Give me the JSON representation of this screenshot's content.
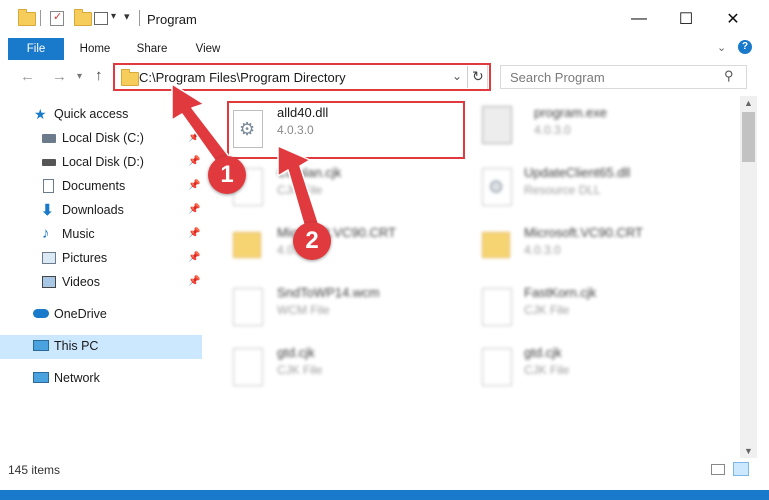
{
  "window": {
    "title": "Program"
  },
  "titlebar": {
    "minimize_icon": "minimize-icon",
    "maximize_icon": "maximize-icon",
    "close_icon": "close-icon"
  },
  "ribbon": {
    "tabs": [
      {
        "label": "File"
      },
      {
        "label": "Home"
      },
      {
        "label": "Share"
      },
      {
        "label": "View"
      }
    ]
  },
  "address": {
    "path": "C:\\Program Files\\Program Directory"
  },
  "search": {
    "placeholder": "Search Program"
  },
  "nav": {
    "items": [
      {
        "label": "Quick access",
        "icon": "star-icon"
      },
      {
        "label": "Local Disk (C:)",
        "icon": "drive-icon"
      },
      {
        "label": "Local Disk (D:)",
        "icon": "drive-icon"
      },
      {
        "label": "Documents",
        "icon": "documents-icon"
      },
      {
        "label": "Downloads",
        "icon": "download-icon"
      },
      {
        "label": "Music",
        "icon": "music-icon"
      },
      {
        "label": "Pictures",
        "icon": "pictures-icon"
      },
      {
        "label": "Videos",
        "icon": "videos-icon"
      },
      {
        "label": "OneDrive",
        "icon": "cloud-icon"
      },
      {
        "label": "This PC",
        "icon": "computer-icon"
      },
      {
        "label": "Network",
        "icon": "network-icon"
      }
    ]
  },
  "files": [
    {
      "name": "alld40.dll",
      "sub": "4.0.3.0"
    },
    {
      "name": "program.exe",
      "sub": "4.0.3.0"
    },
    {
      "name": "Catalan.cjk",
      "sub": "CJK File"
    },
    {
      "name": "UpdateClient65.dll",
      "sub": "Resource DLL"
    },
    {
      "name": "Microsoft.VC90.CRT",
      "sub": "4.0.3.0"
    },
    {
      "name": "Microsoft.VC90.CRT",
      "sub": "4.0.3.0"
    },
    {
      "name": "SndToWP14.wcm",
      "sub": "WCM File"
    },
    {
      "name": "FastKorn.cjk",
      "sub": "CJK File"
    },
    {
      "name": "gtd.cjk",
      "sub": "CJK File"
    },
    {
      "name": "gtd.cjk",
      "sub": "CJK File"
    }
  ],
  "annotations": {
    "step1": "1",
    "step2": "2",
    "accent": "#e03a3f"
  },
  "status": {
    "count": "145 items"
  },
  "colors": {
    "accent_blue": "#1979ca",
    "selected_bg": "#cce8ff"
  }
}
